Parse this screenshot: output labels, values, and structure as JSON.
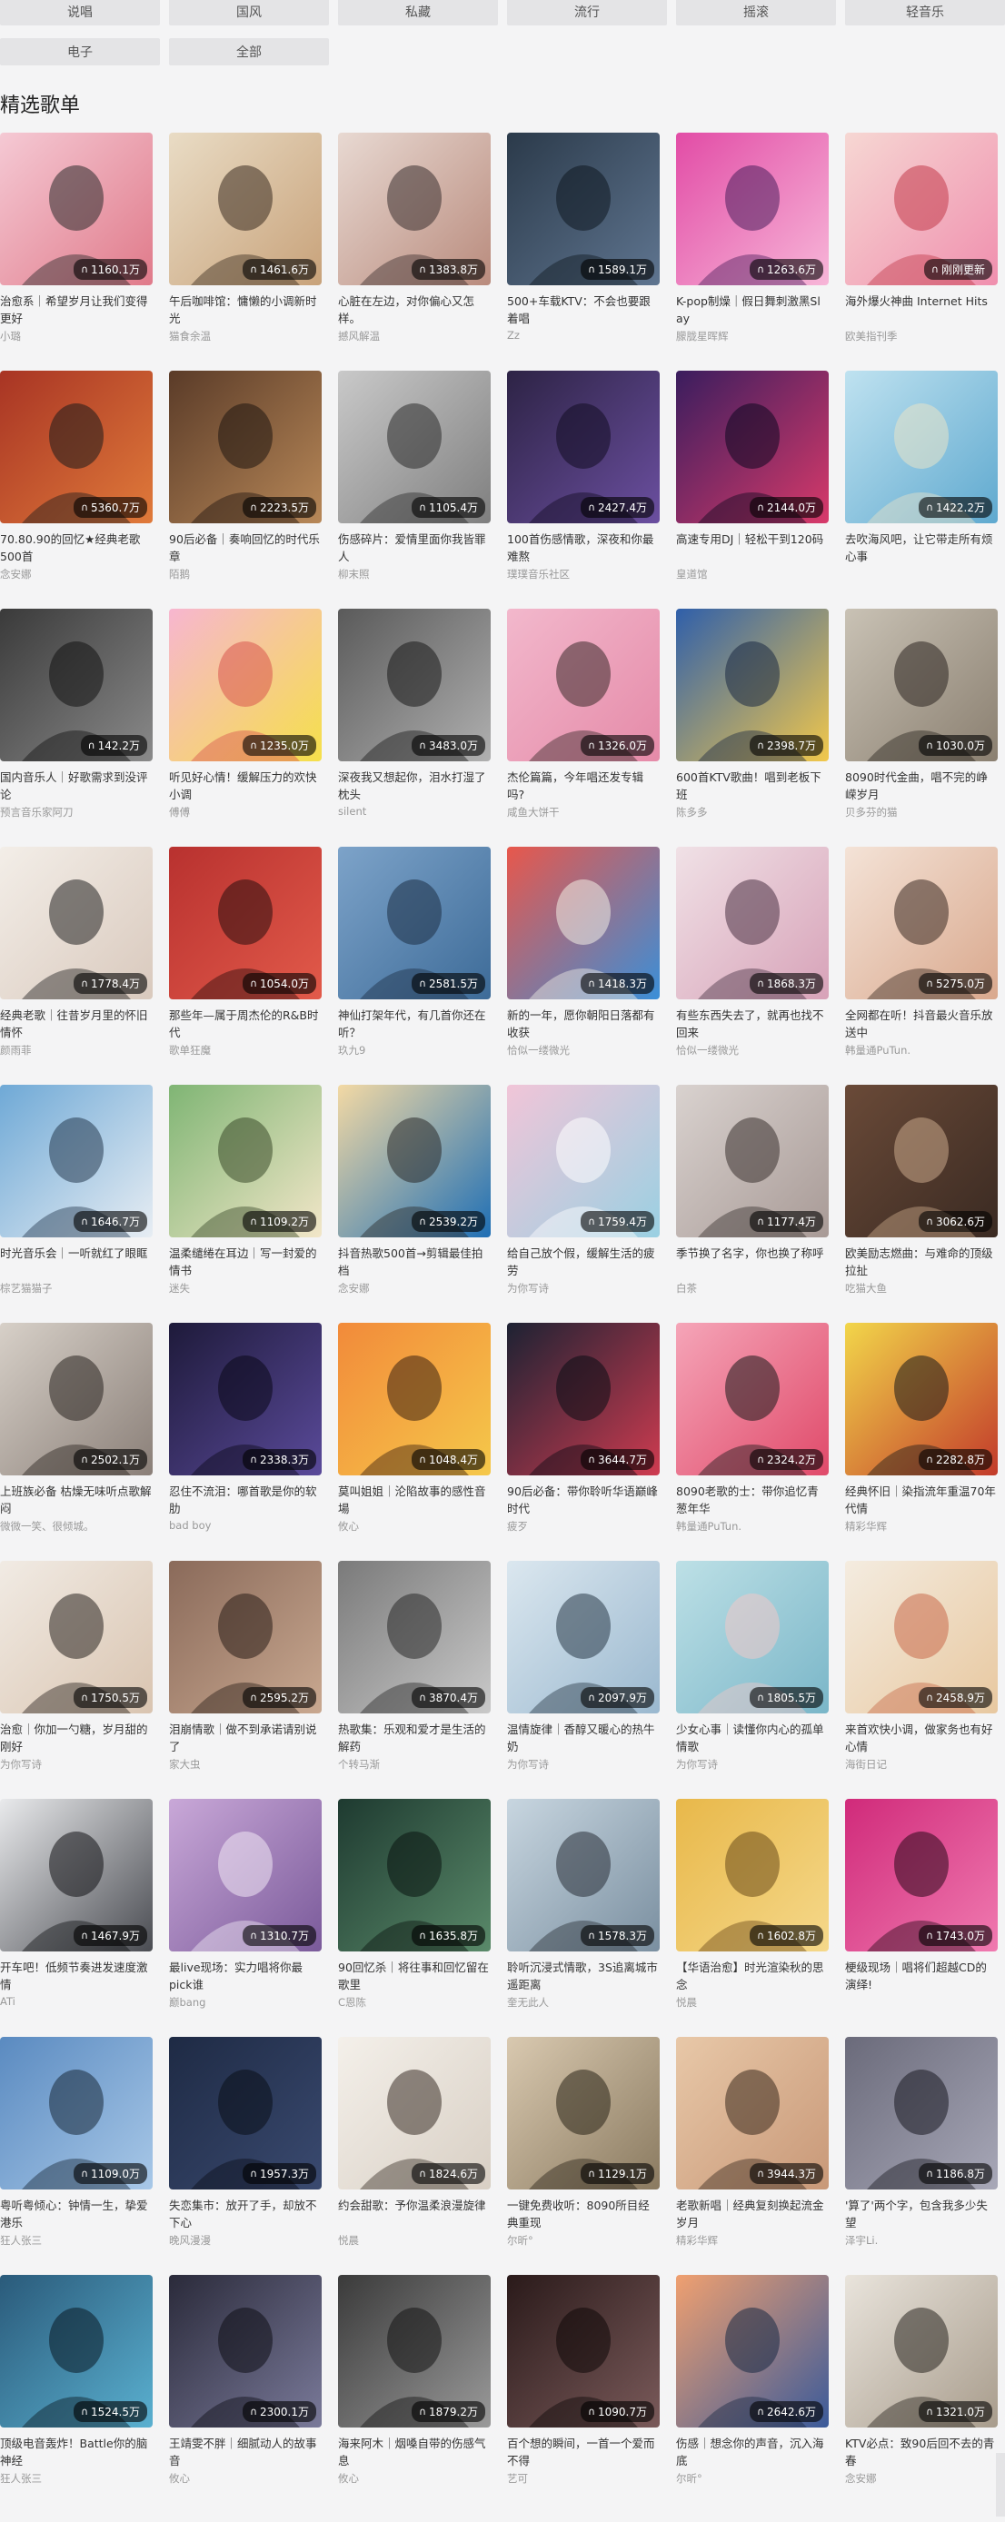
{
  "tags": [
    "说唱",
    "国风",
    "私藏",
    "流行",
    "摇滚",
    "轻音乐",
    "电子",
    "全部"
  ],
  "section_title": "精选歌单",
  "badge_icon": "headphones-icon",
  "playlists": [
    {
      "title": "治愈系｜希望岁月让我们变得更好",
      "author": "小璐",
      "plays": "1160.1万"
    },
    {
      "title": "午后咖啡馆：慵懒的小调新时光",
      "author": "猫食余温",
      "plays": "1461.6万"
    },
    {
      "title": "心脏在左边，对你偏心又怎样。",
      "author": "撼风解温",
      "plays": "1383.8万"
    },
    {
      "title": "500+车载KTV：不会也要跟着唱",
      "author": "Zz",
      "plays": "1589.1万"
    },
    {
      "title": "K-pop制燥｜假日舞刺激黑Sl ay",
      "author": "朦胧星晖辉",
      "plays": "1263.6万"
    },
    {
      "title": "海外爆火神曲 Internet Hits",
      "author": "欧美指刊季",
      "plays": "刚刚更新"
    },
    {
      "title": "70.80.90的回忆★经典老歌500首",
      "author": "念安娜",
      "plays": "5360.7万"
    },
    {
      "title": "90后必备｜奏响回忆的时代乐章",
      "author": "陌鹅",
      "plays": "2223.5万"
    },
    {
      "title": "伤感碎片：爱情里面你我皆罪人",
      "author": "柳末照",
      "plays": "1105.4万"
    },
    {
      "title": "100首伤感情歌，深夜和你最难熬",
      "author": "璞璞音乐社区",
      "plays": "2427.4万"
    },
    {
      "title": "高速专用DJ｜轻松干到120码",
      "author": "皇道馆",
      "plays": "2144.0万"
    },
    {
      "title": "去吹海风吧，让它带走所有烦心事",
      "author": "",
      "plays": "1422.2万"
    },
    {
      "title": "国内音乐人｜好歌需求到没评论",
      "author": "预言音乐家阿刀",
      "plays": "142.2万"
    },
    {
      "title": "听见好心情！缓解压力的欢快小调",
      "author": "傅傅",
      "plays": "1235.0万"
    },
    {
      "title": "深夜我又想起你，泪水打湿了枕头",
      "author": "silent",
      "plays": "3483.0万"
    },
    {
      "title": "杰伦篇篇，今年唱还发专辑吗?",
      "author": "咸鱼大饼干",
      "plays": "1326.0万"
    },
    {
      "title": "600首KTV歌曲！唱到老板下班",
      "author": "陈多多",
      "plays": "2398.7万"
    },
    {
      "title": "8090时代金曲，唱不完的峥嵘岁月",
      "author": "贝多芬的猫",
      "plays": "1030.0万"
    },
    {
      "title": "经典老歌｜往昔岁月里的怀旧情怀",
      "author": "颜雨菲",
      "plays": "1778.4万"
    },
    {
      "title": "那些年—属于周杰伦的R&B时代",
      "author": "歌单狂魔",
      "plays": "1054.0万"
    },
    {
      "title": "神仙打架年代，有几首你还在听？",
      "author": "玖九9",
      "plays": "2581.5万"
    },
    {
      "title": "新的一年，愿你朝阳日落都有收获",
      "author": "恰似一缕微光",
      "plays": "1418.3万"
    },
    {
      "title": "有些东西失去了，就再也找不回来",
      "author": "恰似一缕微光",
      "plays": "1868.3万"
    },
    {
      "title": "全网都在听！抖音最火音乐放送中",
      "author": "韩量通PuTun.",
      "plays": "5275.0万"
    },
    {
      "title": "时光音乐会｜一听就红了眼眶",
      "author": "棕艺猫猫子",
      "plays": "1646.7万"
    },
    {
      "title": "温柔缱绻在耳边｜写一封爱的情书",
      "author": "迷失",
      "plays": "1109.2万"
    },
    {
      "title": "抖音热歌500首→剪辑最佳拍档",
      "author": "念安娜",
      "plays": "2539.2万"
    },
    {
      "title": "给自己放个假，缓解生活的疲劳",
      "author": "为你写诗",
      "plays": "1759.4万"
    },
    {
      "title": "季节换了名字，你也换了称呼",
      "author": "白茶",
      "plays": "1177.4万"
    },
    {
      "title": "欧美励志燃曲：与难命的顶级拉扯",
      "author": "吃猫大鱼",
      "plays": "3062.6万"
    },
    {
      "title": "上班族必备 枯燥无味听点歌解闷",
      "author": "微微一笑、很倾城。",
      "plays": "2502.1万"
    },
    {
      "title": "忍住不流泪：哪首歌是你的软肋",
      "author": "bad boy",
      "plays": "2338.3万"
    },
    {
      "title": "莫叫姐姐｜沦陷故事的感性音場",
      "author": "攸心",
      "plays": "1048.4万"
    },
    {
      "title": "90后必备：带你聆听华语巅峰时代",
      "author": "疲歹",
      "plays": "3644.7万"
    },
    {
      "title": "8090老歌的士：带你追忆青葱年华",
      "author": "韩量通PuTun.",
      "plays": "2324.2万"
    },
    {
      "title": "经典怀旧｜染指流年重温70年代情",
      "author": "精彩华辉",
      "plays": "2282.8万"
    },
    {
      "title": "治愈｜你加一勺糖，岁月甜的刚好",
      "author": "为你写诗",
      "plays": "1750.5万"
    },
    {
      "title": "泪崩情歌｜做不到承诺请别说了",
      "author": "家大虫",
      "plays": "2595.2万"
    },
    {
      "title": "热歌集：乐观和爱才是生活的解药",
      "author": "个转马渐",
      "plays": "3870.4万"
    },
    {
      "title": "温情旋律｜香醇又暖心的热牛奶",
      "author": "为你写诗",
      "plays": "2097.9万"
    },
    {
      "title": "少女心事｜读懂你内心的孤单情歌",
      "author": "为你写诗",
      "plays": "1805.5万"
    },
    {
      "title": "来首欢快小调，做家务也有好心情",
      "author": "海街日记",
      "plays": "2458.9万"
    },
    {
      "title": "开车吧！低频节奏进发速度激情",
      "author": "ATi",
      "plays": "1467.9万"
    },
    {
      "title": "最live现场：实力唱将你最pick谁",
      "author": "巅bang",
      "plays": "1310.7万"
    },
    {
      "title": "90回忆杀｜将往事和回忆留在歌里",
      "author": "C恩陈",
      "plays": "1635.8万"
    },
    {
      "title": "聆听沉浸式情歌，3S追离城市遥距离",
      "author": "奎无此人",
      "plays": "1578.3万"
    },
    {
      "title": "【华语治愈】时光渲染秋的思念",
      "author": "悦晨",
      "plays": "1602.8万"
    },
    {
      "title": "梗级现场｜唱将们超越CD的演绎!",
      "author": "",
      "plays": "1743.0万"
    },
    {
      "title": "粤听粤倾心：钟情一生，挚爱港乐",
      "author": "狂人张三",
      "plays": "1109.0万"
    },
    {
      "title": "失恋集市：放开了手，却放不下心",
      "author": "晚风漫漫",
      "plays": "1957.3万"
    },
    {
      "title": "约会甜歌：予你温柔浪漫旋律",
      "author": "悦晨",
      "plays": "1824.6万"
    },
    {
      "title": "一键免费收听：8090所目经典重现",
      "author": "尔昕°",
      "plays": "1129.1万"
    },
    {
      "title": "老歌新唱｜经典复刻换起流金岁月",
      "author": "精彩华辉",
      "plays": "3944.3万"
    },
    {
      "title": "'算了'两个字，包含我多少失望",
      "author": "泽宇Li.",
      "plays": "1186.8万"
    },
    {
      "title": "顶级电音轰炸！Battle你的脑神经",
      "author": "狂人张三",
      "plays": "1524.5万"
    },
    {
      "title": "王靖雯不胖｜细腻动人的故事音",
      "author": "攸心",
      "plays": "2300.1万"
    },
    {
      "title": "海来阿木｜烟嗓自带的伤感气息",
      "author": "攸心",
      "plays": "1879.2万"
    },
    {
      "title": "百个想的瞬间，一首一个爱而不得",
      "author": "艺可",
      "plays": "1090.7万"
    },
    {
      "title": "伤感｜想念你的声音，沉入海底",
      "author": "尔昕°",
      "plays": "2642.6万"
    },
    {
      "title": "KTV必点：致90后回不去的青春",
      "author": "念安娜",
      "plays": "1321.0万"
    }
  ],
  "cover_palettes": [
    [
      "#f5c9d4",
      "#e07a8a",
      "#2b2b2b"
    ],
    [
      "#e9dcc5",
      "#c8a27a",
      "#3a2c20"
    ],
    [
      "#e8d9d2",
      "#b98b7d",
      "#3b2f2f"
    ],
    [
      "#2b3a4a",
      "#5f7590",
      "#0f1820"
    ],
    [
      "#e24ca6",
      "#f7b6d8",
      "#4b1f5d"
    ],
    [
      "#f6d7d3",
      "#f08fae",
      "#c23a4a"
    ],
    [
      "#a83424",
      "#e07a3a",
      "#1c1c1c"
    ],
    [
      "#5a3b28",
      "#b88858",
      "#1f1510"
    ],
    [
      "#c9c9c9",
      "#7f7f7f",
      "#2c2c2c"
    ],
    [
      "#2d2345",
      "#6b4fa0",
      "#120c22"
    ],
    [
      "#3a1d5e",
      "#d83a6a",
      "#0d0820"
    ],
    [
      "#bfe2f0",
      "#5fa9cf",
      "#e8e3c8"
    ],
    [
      "#3a3a3a",
      "#8a8a8a",
      "#121212"
    ],
    [
      "#f7b6d0",
      "#f5e04a",
      "#d9554f"
    ],
    [
      "#5a5a5a",
      "#b0b0b0",
      "#1a1a1a"
    ],
    [
      "#f2b8cc",
      "#e58aa8",
      "#3a2a2a"
    ],
    [
      "#2f5faa",
      "#f2c84b",
      "#1c2a44"
    ],
    [
      "#c9c2b5",
      "#8a7f70",
      "#2b2520"
    ],
    [
      "#f3eee8",
      "#d9c9bd",
      "#222222"
    ],
    [
      "#b8312f",
      "#e25a4a",
      "#2a0e0e"
    ],
    [
      "#7da3c9",
      "#3d6b98",
      "#1d2f45"
    ],
    [
      "#e8574b",
      "#3a8fd8",
      "#f2efe4"
    ],
    [
      "#f0e1e6",
      "#d7a2b8",
      "#4a3244"
    ],
    [
      "#f4e3d7",
      "#d9a88d",
      "#3a2a22"
    ],
    [
      "#6fa9d6",
      "#e7edf3",
      "#263a50"
    ],
    [
      "#7fb574",
      "#f2e6c8",
      "#3a4a2a"
    ],
    [
      "#f3d9a4",
      "#1f6fb5",
      "#2a2a2a"
    ],
    [
      "#f1c5d8",
      "#9ad0e2",
      "#ffffff"
    ],
    [
      "#d9d2cf",
      "#a89a96",
      "#3a3230"
    ],
    [
      "#6a4a38",
      "#3a2a22",
      "#c9a88a"
    ],
    [
      "#d7d0c8",
      "#8a7f78",
      "#2a2420"
    ],
    [
      "#1e1a3a",
      "#5a4a9a",
      "#0a0818"
    ],
    [
      "#f28a3a",
      "#f5c84a",
      "#3a2010"
    ],
    [
      "#1d2233",
      "#ce3b50",
      "#0a0c14"
    ],
    [
      "#f5a5b8",
      "#e04a6a",
      "#1a1a1a"
    ],
    [
      "#f2d64a",
      "#c23a2a",
      "#1a1a1a"
    ],
    [
      "#f1ebe4",
      "#d9c4b0",
      "#2a2420"
    ],
    [
      "#8a6a5a",
      "#c9a890",
      "#2a1e18"
    ],
    [
      "#7a7a7a",
      "#c9c9c9",
      "#2a2a2a"
    ],
    [
      "#dbe7ef",
      "#9ab8cf",
      "#2a3a48"
    ],
    [
      "#bde0e6",
      "#7ab6c8",
      "#f0c8c8"
    ],
    [
      "#f4ece0",
      "#e8c8a0",
      "#c86a4a"
    ],
    [
      "#e9eaec",
      "#4a4c52",
      "#121316"
    ],
    [
      "#c9a8d8",
      "#7a5a9a",
      "#f0e8f4"
    ],
    [
      "#1e3a30",
      "#5a8a6a",
      "#0a1410"
    ],
    [
      "#c8d6e0",
      "#7a8fa0",
      "#2a3038"
    ],
    [
      "#e8b84a",
      "#f5d88a",
      "#6a4a1a"
    ],
    [
      "#d02a7a",
      "#f07ab0",
      "#2a0a1a"
    ],
    [
      "#5a8ac0",
      "#a8c8e8",
      "#1a2a3a"
    ],
    [
      "#1e2a44",
      "#3a4a70",
      "#0a0e18"
    ],
    [
      "#f4f0ea",
      "#d8cfc4",
      "#3a3028"
    ],
    [
      "#d9c9b0",
      "#8a7a60",
      "#2a2418"
    ],
    [
      "#e8c8a8",
      "#c89878",
      "#3a2a1e"
    ],
    [
      "#6a6a7a",
      "#a8a8b8",
      "#1a1a22"
    ],
    [
      "#2a5a7a",
      "#5ab0d0",
      "#0a1a24"
    ],
    [
      "#2a2a3a",
      "#7a7a9a",
      "#0e0e16"
    ],
    [
      "#3a3a3a",
      "#9a9a9a",
      "#141414"
    ],
    [
      "#2a1a1a",
      "#7a5a5a",
      "#0e0808"
    ],
    [
      "#f0a070",
      "#3a5a9a",
      "#1a2a44"
    ],
    [
      "#e9e4dc",
      "#a89c8c",
      "#2a2620"
    ]
  ]
}
